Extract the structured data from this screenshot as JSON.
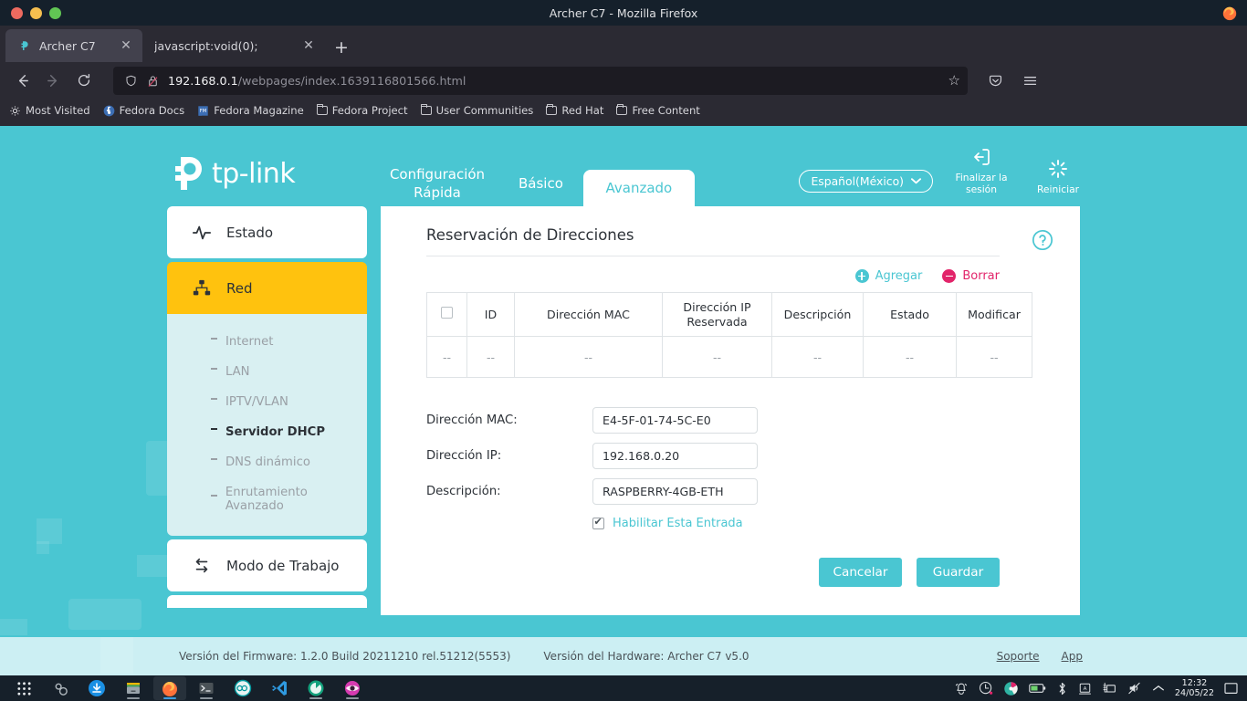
{
  "window": {
    "title": "Archer C7 - Mozilla Firefox",
    "controls": {
      "close": "close",
      "minimize": "minimize",
      "maximize": "maximize"
    },
    "app_icon": "firefox-icon"
  },
  "tabs": [
    {
      "title": "Archer C7",
      "favicon": "tplink-favicon",
      "close": "✕",
      "active": true
    },
    {
      "title": "javascript:void(0);",
      "favicon": "none",
      "close": "✕",
      "active": false
    }
  ],
  "newtab_label": "+",
  "nav": {
    "back": "←",
    "forward": "→",
    "reload": "⟳",
    "url_host": "192.168.0.1",
    "url_path": "/webpages/index.1639116801566.html",
    "shield_icon": "shield-icon",
    "lock_broken_icon": "lock-broken-icon",
    "bookmark_star": "☆",
    "pocket_icon": "pocket-icon",
    "menu_icon": "hamburger-menu-icon"
  },
  "bookmarks": [
    {
      "label": "Most Visited",
      "icon": "gear-icon"
    },
    {
      "label": "Fedora Docs",
      "icon": "fedora-icon"
    },
    {
      "label": "Fedora Magazine",
      "icon": "fedora-magazine-icon"
    },
    {
      "label": "Fedora Project",
      "icon": "folder-icon"
    },
    {
      "label": "User Communities",
      "icon": "folder-icon"
    },
    {
      "label": "Red Hat",
      "icon": "folder-icon"
    },
    {
      "label": "Free Content",
      "icon": "folder-icon"
    }
  ],
  "router": {
    "brand": "tp-link",
    "nav_tabs": [
      {
        "label": "Configuración Rápida",
        "active": false
      },
      {
        "label": "Básico",
        "active": false
      },
      {
        "label": "Avanzado",
        "active": true
      }
    ],
    "language": "Español(México)",
    "language_caret": "chevron-down-icon",
    "logout": "Finalizar la sesión",
    "reboot": "Reiniciar",
    "sidebar": [
      {
        "label": "Estado",
        "icon": "pulse-icon",
        "type": "main",
        "active": false
      },
      {
        "label": "Red",
        "icon": "network-icon",
        "type": "main",
        "active": true
      },
      {
        "label": "Internet",
        "type": "sub",
        "active": false
      },
      {
        "label": "LAN",
        "type": "sub",
        "active": false
      },
      {
        "label": "IPTV/VLAN",
        "type": "sub",
        "active": false
      },
      {
        "label": "Servidor DHCP",
        "type": "sub",
        "active": true
      },
      {
        "label": "DNS dinámico",
        "type": "sub",
        "active": false
      },
      {
        "label": "Enrutamiento Avanzado",
        "type": "sub",
        "active": false
      },
      {
        "label": "Modo de Trabajo",
        "icon": "swap-icon",
        "type": "main",
        "active": false
      }
    ],
    "panel": {
      "title": "Reservación de Direcciones",
      "help_icon": "help-circle-icon",
      "actions": {
        "add": "Agregar",
        "delete": "Borrar"
      },
      "table": {
        "columns": [
          "",
          "ID",
          "Dirección MAC",
          "Dirección IP Reservada",
          "Descripción",
          "Estado",
          "Modificar"
        ],
        "rows": [
          [
            "--",
            "--",
            "--",
            "--",
            "--",
            "--",
            "--"
          ]
        ]
      },
      "form": {
        "fields": [
          {
            "label": "Dirección MAC:",
            "value": "E4-5F-01-74-5C-E0",
            "placeholder": ""
          },
          {
            "label": "Dirección IP:",
            "value": "192.168.0.20",
            "placeholder": ""
          },
          {
            "label": "Descripción:",
            "value": "RASPBERRY-4GB-ETH",
            "placeholder": ""
          }
        ],
        "checkbox": {
          "label": "Habilitar Esta Entrada",
          "checked": true
        },
        "cancel": "Cancelar",
        "save": "Guardar"
      }
    },
    "footer": {
      "firmware": "Versión del Firmware: 1.2.0 Build 20211210 rel.51212(5553)",
      "hardware": "Versión del Hardware: Archer C7 v5.0",
      "support": "Soporte",
      "app": "App"
    },
    "colors": {
      "teal": "#4ac6d2",
      "yellow": "#ffc20e",
      "pink": "#e2246a",
      "submenu_bg": "#d9f0f2"
    }
  },
  "taskbar": {
    "apps": [
      {
        "name": "app-grid-icon",
        "running": false
      },
      {
        "name": "settings-gear-icon",
        "running": false
      },
      {
        "name": "download-icon",
        "running": false
      },
      {
        "name": "files-icon",
        "running": true
      },
      {
        "name": "firefox-icon",
        "running": true,
        "active": true
      },
      {
        "name": "terminal-icon",
        "running": true
      },
      {
        "name": "arduino-icon",
        "running": false
      },
      {
        "name": "vscode-icon",
        "running": false
      },
      {
        "name": "green-app-icon",
        "running": true
      },
      {
        "name": "eye-app-icon",
        "running": true
      }
    ],
    "tray": [
      "notification-bell-icon",
      "updates-icon",
      "color-palette-icon",
      "battery-icon",
      "bluetooth-icon",
      "keyboard-layout-icon",
      "network-icon",
      "volume-muted-icon",
      "chevron-up-icon"
    ],
    "clock_time": "12:32",
    "clock_date": "24/05/22",
    "show_desktop": "show-desktop-icon"
  }
}
